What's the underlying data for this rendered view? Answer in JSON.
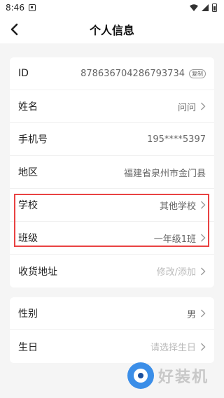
{
  "status_bar": {
    "time": "8:46"
  },
  "header": {
    "title": "个人信息"
  },
  "profile": {
    "rows": [
      {
        "label": "ID",
        "value": "878636704286793734",
        "badge": "复制"
      },
      {
        "label": "姓名",
        "value": "问问"
      },
      {
        "label": "手机号",
        "value": "195****5397"
      },
      {
        "label": "地区",
        "value": "福建省泉州市金门县"
      },
      {
        "label": "学校",
        "value": "其他学校"
      },
      {
        "label": "班级",
        "value": "一年级1班"
      },
      {
        "label": "收货地址",
        "value": "修改/添加"
      }
    ]
  },
  "personal": {
    "rows": [
      {
        "label": "性别",
        "value": "男"
      },
      {
        "label": "生日",
        "value": "请选择生日"
      }
    ]
  },
  "watermark": {
    "text": "好装机"
  },
  "colors": {
    "highlight": "#e94242",
    "accent": "#3b8ee8"
  }
}
